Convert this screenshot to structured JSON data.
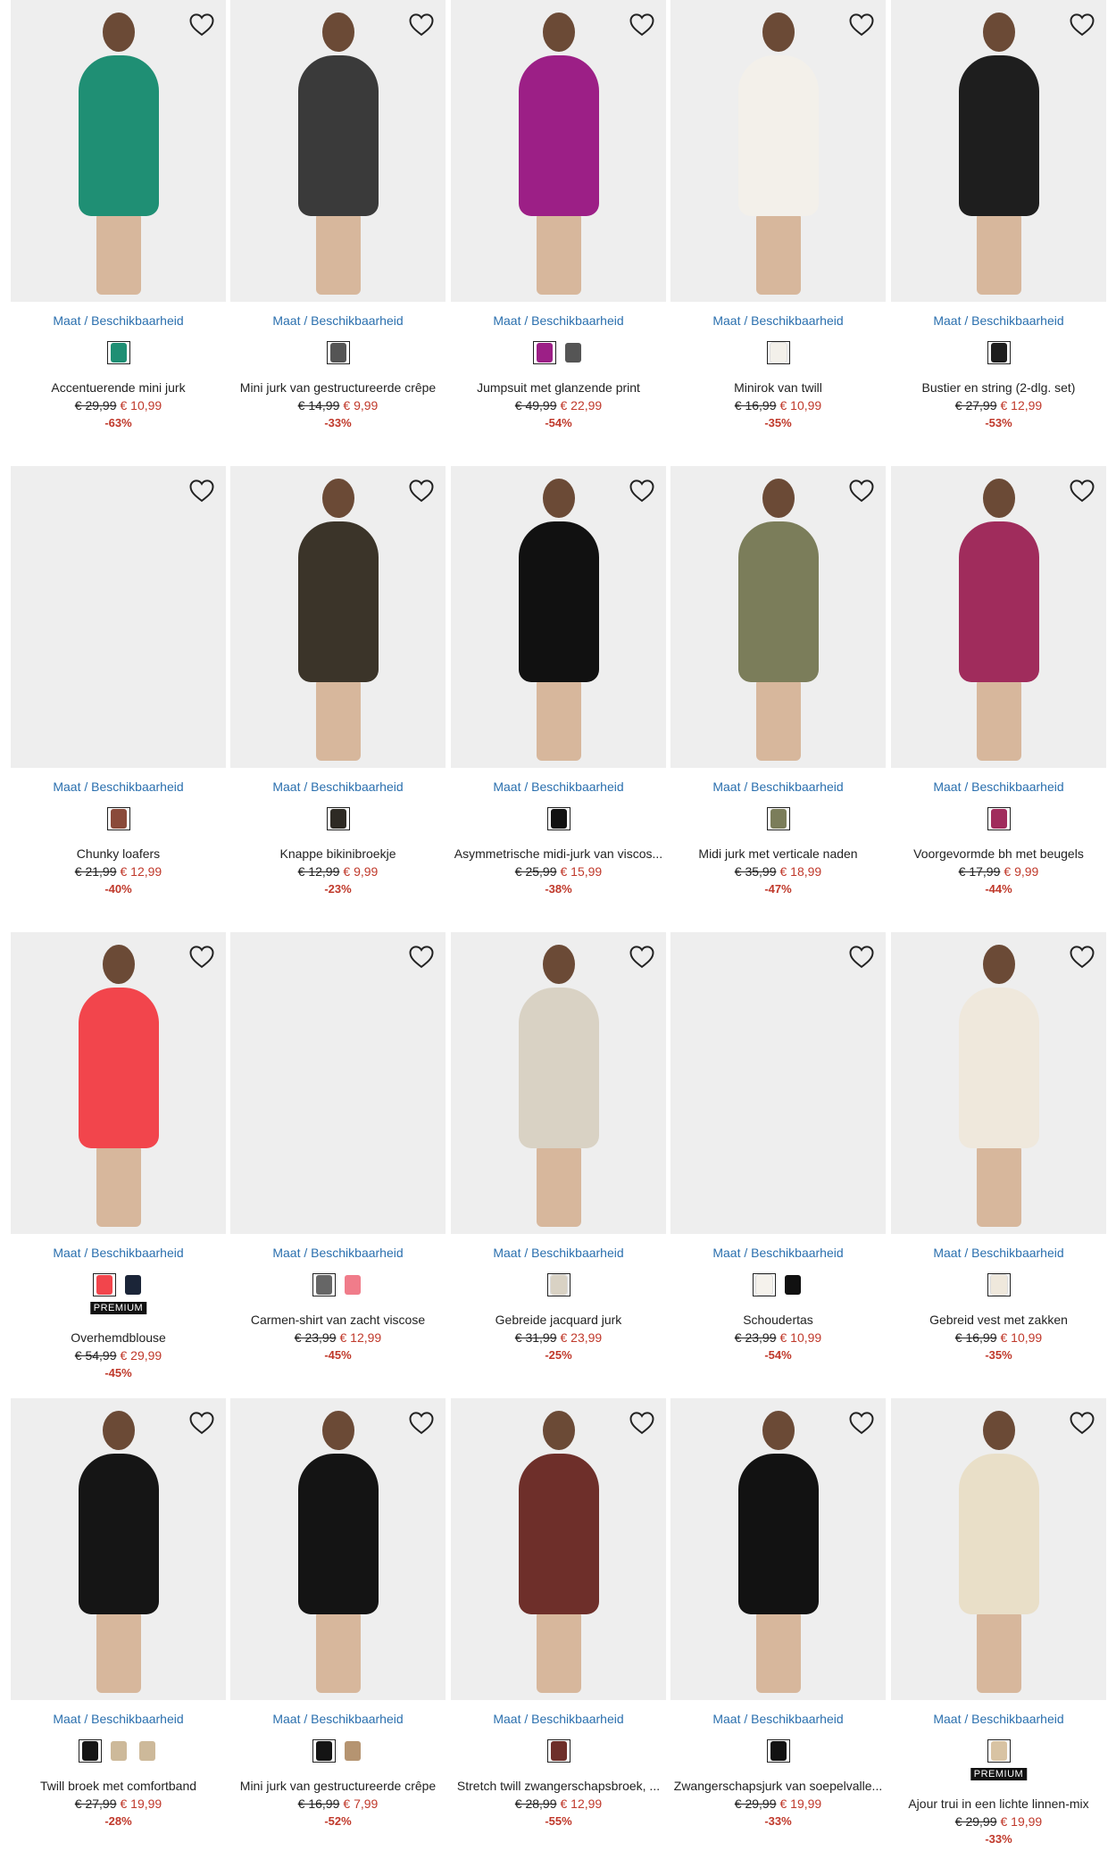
{
  "size_link_label": "Maat / Beschikbaarheid",
  "premium_label": "PREMIUM",
  "products": [
    {
      "title": "Accentuerende mini jurk",
      "old_price": "€ 29,99",
      "new_price": "€ 10,99",
      "discount": "-63%",
      "image_color": "#1f8f74",
      "swatches": [
        "#1f8f74"
      ],
      "premium": false
    },
    {
      "title": "Mini jurk van gestructureerde crêpe",
      "old_price": "€ 14,99",
      "new_price": "€ 9,99",
      "discount": "-33%",
      "image_color": "#3a3a3a",
      "swatches": [
        "#555555"
      ],
      "premium": false
    },
    {
      "title": "Jumpsuit met glanzende print",
      "old_price": "€ 49,99",
      "new_price": "€ 22,99",
      "discount": "-54%",
      "image_color": "#9c1f86",
      "swatches": [
        "#9c1f86",
        "#555555"
      ],
      "premium": false
    },
    {
      "title": "Minirok van twill",
      "old_price": "€ 16,99",
      "new_price": "€ 10,99",
      "discount": "-35%",
      "image_color": "#f3f0ea",
      "swatches": [
        "#f3f0ea"
      ],
      "premium": false
    },
    {
      "title": "Bustier en string (2-dlg. set)",
      "old_price": "€ 27,99",
      "new_price": "€ 12,99",
      "discount": "-53%",
      "image_color": "#1e1e1e",
      "swatches": [
        "#1e1e1e"
      ],
      "premium": false
    },
    {
      "title": "Chunky loafers",
      "old_price": "€ 21,99",
      "new_price": "€ 12,99",
      "discount": "-40%",
      "image_color": "#f0f0f0",
      "swatches": [
        "#8a4a3a"
      ],
      "premium": false
    },
    {
      "title": "Knappe bikinibroekje",
      "old_price": "€ 12,99",
      "new_price": "€ 9,99",
      "discount": "-23%",
      "image_color": "#3b3429",
      "swatches": [
        "#2e2a24"
      ],
      "premium": false
    },
    {
      "title": "Asymmetrische midi-jurk van viscos...",
      "old_price": "€ 25,99",
      "new_price": "€ 15,99",
      "discount": "-38%",
      "image_color": "#111111",
      "swatches": [
        "#111111"
      ],
      "premium": false
    },
    {
      "title": "Midi jurk met verticale naden",
      "old_price": "€ 35,99",
      "new_price": "€ 18,99",
      "discount": "-47%",
      "image_color": "#7b7d5a",
      "swatches": [
        "#7b7d5a"
      ],
      "premium": false
    },
    {
      "title": "Voorgevormde bh met beugels",
      "old_price": "€ 17,99",
      "new_price": "€ 9,99",
      "discount": "-44%",
      "image_color": "#a02c5c",
      "swatches": [
        "#a02c5c"
      ],
      "premium": false
    },
    {
      "title": "Overhemdblouse",
      "old_price": "€ 54,99",
      "new_price": "€ 29,99",
      "discount": "-45%",
      "image_color": "#f2454c",
      "swatches": [
        "#f2454c",
        "#1b2538"
      ],
      "premium": true
    },
    {
      "title": "Carmen-shirt van zacht viscose",
      "old_price": "€ 23,99",
      "new_price": "€ 12,99",
      "discount": "-45%",
      "image_color": "#f3f3f3",
      "swatches": [
        "#666666",
        "#f07c8a"
      ],
      "premium": false
    },
    {
      "title": "Gebreide jacquard jurk",
      "old_price": "€ 31,99",
      "new_price": "€ 23,99",
      "discount": "-25%",
      "image_color": "#d9d2c4",
      "swatches": [
        "#d9d2c4"
      ],
      "premium": false
    },
    {
      "title": "Schoudertas",
      "old_price": "€ 23,99",
      "new_price": "€ 10,99",
      "discount": "-54%",
      "image_color": "#f5f5f5",
      "swatches": [
        "#f5f2ec",
        "#111111"
      ],
      "premium": false
    },
    {
      "title": "Gebreid vest met zakken",
      "old_price": "€ 16,99",
      "new_price": "€ 10,99",
      "discount": "-35%",
      "image_color": "#efe8dc",
      "swatches": [
        "#efe8dc"
      ],
      "premium": false
    },
    {
      "title": "Twill broek met comfortband",
      "old_price": "€ 27,99",
      "new_price": "€ 19,99",
      "discount": "-28%",
      "image_color": "#151515",
      "swatches": [
        "#151515",
        "#cdb99a",
        "#cdb99a"
      ],
      "premium": false
    },
    {
      "title": "Mini jurk van gestructureerde crêpe",
      "old_price": "€ 16,99",
      "new_price": "€ 7,99",
      "discount": "-52%",
      "image_color": "#141414",
      "swatches": [
        "#141414",
        "#b59471"
      ],
      "premium": false
    },
    {
      "title": "Stretch twill zwangerschapsbroek, ...",
      "old_price": "€ 28,99",
      "new_price": "€ 12,99",
      "discount": "-55%",
      "image_color": "#6e2f2a",
      "swatches": [
        "#6e2f2a"
      ],
      "premium": false
    },
    {
      "title": "Zwangerschapsjurk van soepelvalle...",
      "old_price": "€ 29,99",
      "new_price": "€ 19,99",
      "discount": "-33%",
      "image_color": "#121212",
      "swatches": [
        "#121212"
      ],
      "premium": false
    },
    {
      "title": "Ajour trui in een lichte linnen-mix",
      "old_price": "€ 29,99",
      "new_price": "€ 19,99",
      "discount": "-33%",
      "image_color": "#e9dfc8",
      "swatches": [
        "#d8c3a3"
      ],
      "premium": true
    }
  ]
}
